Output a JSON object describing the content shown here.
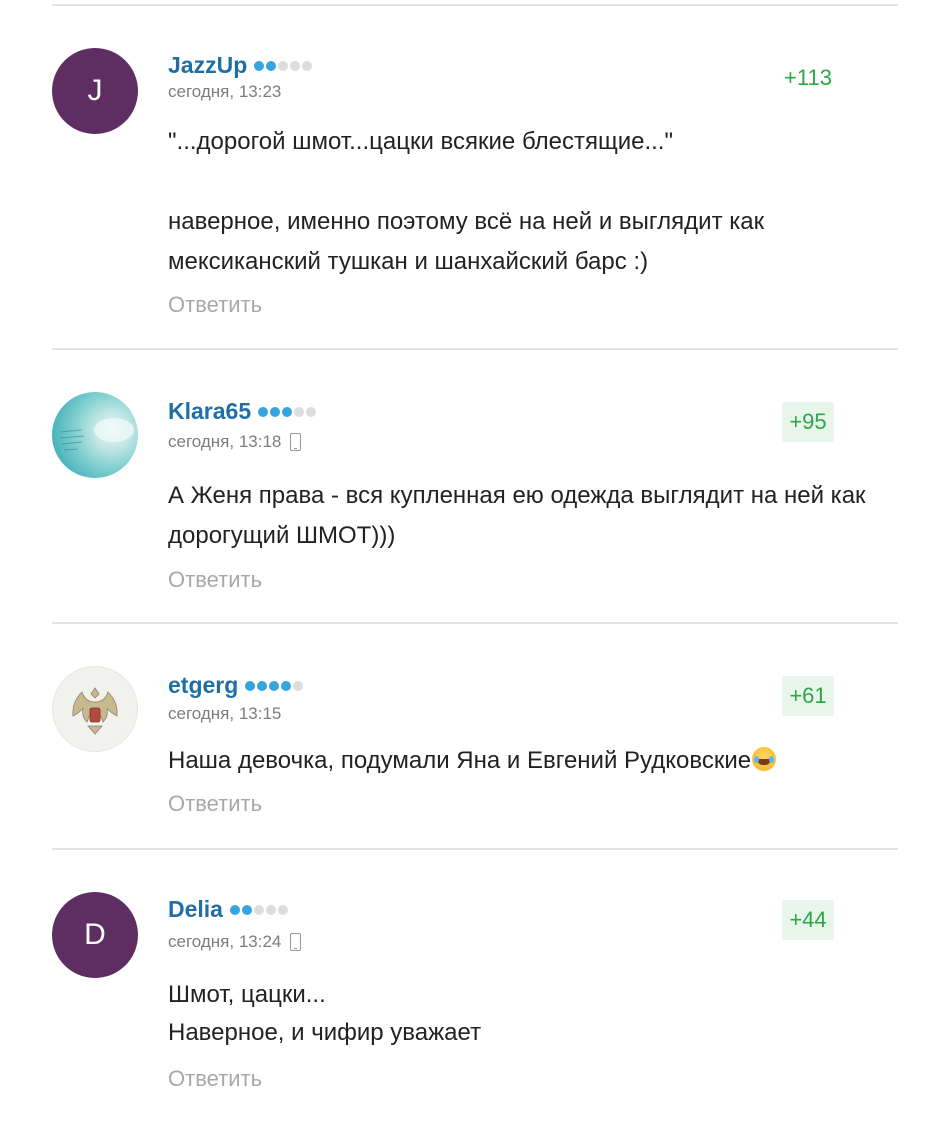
{
  "comments": [
    {
      "avatar_letter": "J",
      "avatar_color": "#5e2e63",
      "author": "JazzUp",
      "rank_level": 2,
      "rank_max": 5,
      "time": "сегодня, 13:23",
      "mobile": false,
      "score": "+113",
      "text_lines": [
        "\"...дорогой шмот...цацки всякие блестящие...\"",
        "",
        "наверное, именно поэтому всё на ней и выглядит как мексиканский тушкан и шанхайский барс :)"
      ],
      "reply_label": "Ответить"
    },
    {
      "avatar_letter": "",
      "avatar_icon": "sea-photo",
      "author": "Klara65",
      "rank_level": 3,
      "rank_max": 5,
      "time": "сегодня, 13:18",
      "mobile": true,
      "score": "+95",
      "text_lines": [
        "А Женя права - вся купленная ею одежда выглядит на ней как дорогущий ШМОТ)))"
      ],
      "reply_label": "Ответить"
    },
    {
      "avatar_letter": "",
      "avatar_icon": "coat-of-arms",
      "author": "etgerg",
      "rank_level": 4,
      "rank_max": 5,
      "time": "сегодня, 13:15",
      "mobile": false,
      "score": "+61",
      "text_lines": [
        "Наша девочка, подумали Яна и Евгений Рудковские"
      ],
      "emoji": "laughing-tears-emoji",
      "reply_label": "Ответить"
    },
    {
      "avatar_letter": "D",
      "avatar_color": "#5e2e63",
      "author": "Delia",
      "rank_level": 2,
      "rank_max": 5,
      "time": "сегодня, 13:24",
      "mobile": true,
      "score": "+44",
      "text_lines": [
        "Шмот, цацки...",
        "Наверное, и чифир уважает"
      ],
      "reply_label": "Ответить"
    }
  ],
  "colors": {
    "author": "#1f6fa6",
    "score": "#2aa845",
    "score_bg": "#e8f5ea",
    "rank_on": "#36a4de",
    "rank_off": "#dddddd",
    "reply": "#a8a8a8",
    "meta": "#7d7d7d"
  }
}
